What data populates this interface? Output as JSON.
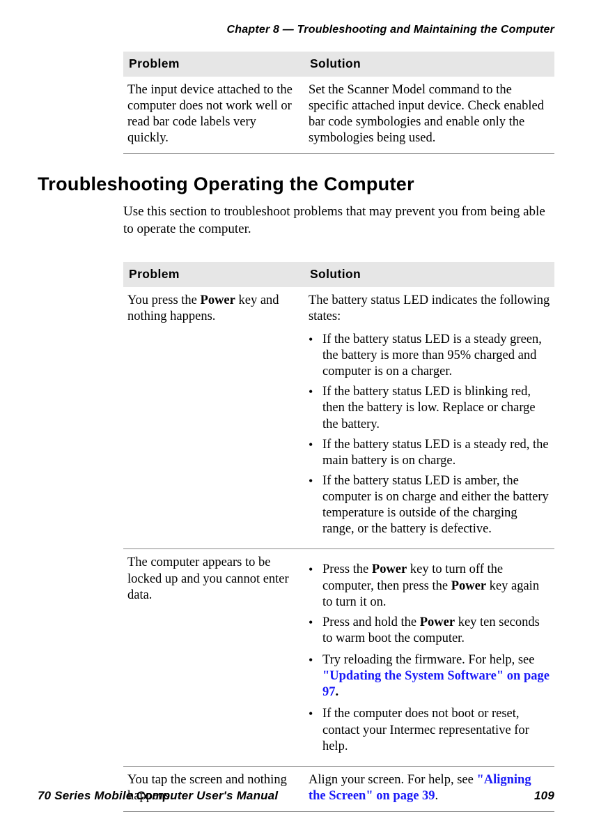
{
  "header": {
    "chapter_line": "Chapter 8 — Troubleshooting and Maintaining the Computer"
  },
  "table1": {
    "col_problem": "Problem",
    "col_solution": "Solution",
    "row1": {
      "problem": "The input device attached to the computer does not work well or read bar code labels very quickly.",
      "solution": "Set the Scanner Model command to the specific attached input device. Check enabled bar code symbologies and enable only the symbologies being used."
    }
  },
  "section": {
    "heading": "Troubleshooting Operating the Computer",
    "intro": "Use this section to troubleshoot problems that may prevent you from being able to operate the computer."
  },
  "table2": {
    "col_problem": "Problem",
    "col_solution": "Solution",
    "row1": {
      "problem_pre": "You press the ",
      "problem_bold": "Power",
      "problem_post": " key and nothing happens.",
      "sol_intro": "The battery status LED indicates the following states:",
      "b1": "If the battery status LED is a steady green, the battery is more than 95% charged and computer is on a charger.",
      "b2": "If the battery status LED is blinking red, then the battery is low. Replace or charge the battery.",
      "b3": "If the battery status LED is a steady red, the main battery is on charge.",
      "b4": "If the battery status LED is amber, the computer is on charge and either the battery temperature is outside of the charging range, or the battery is defective."
    },
    "row2": {
      "problem": "The computer appears to be locked up and you cannot enter data.",
      "b1_pre": "Press the ",
      "b1_bold1": "Power",
      "b1_mid": " key to turn off the computer, then press the ",
      "b1_bold2": "Power",
      "b1_post": " key again to turn it on.",
      "b2_pre": "Press and hold the ",
      "b2_bold": "Power",
      "b2_post": " key ten seconds to warm boot the computer.",
      "b3_pre": "Try reloading the firmware. For help, see ",
      "b3_link": "\"Updating the System Software\" on page 97",
      "b3_post": ".",
      "b4": "If the computer does not boot or reset, contact your Intermec representative for help."
    },
    "row3": {
      "problem": "You tap the screen and nothing happens.",
      "sol_pre": "Align your screen. For help, see ",
      "sol_link": "\"Aligning the Screen\" on page 39",
      "sol_post": "."
    }
  },
  "footer": {
    "manual": "70 Series Mobile Computer User's Manual",
    "page": "109"
  }
}
